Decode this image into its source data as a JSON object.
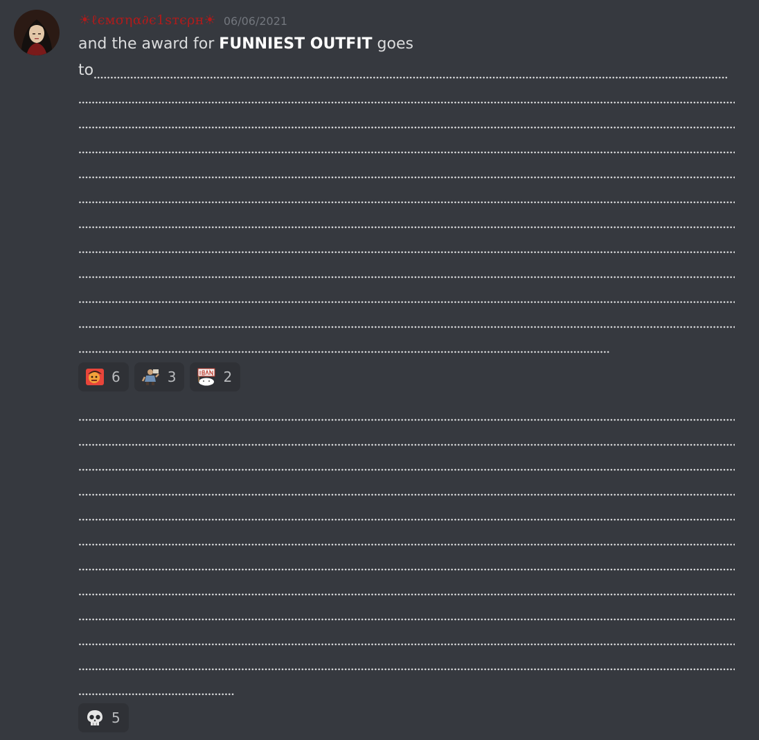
{
  "message": {
    "username": "☀ℓємσηα∂є1ѕтєρн☀",
    "timestamp": "06/06/2021",
    "text_before": "and the award for ",
    "text_bold": "FUNNIEST OUTFIT",
    "text_after": " goes",
    "line2_start": "to"
  },
  "reactions_top": [
    {
      "emoji": "cartoon-character-face-emoji",
      "count": "6"
    },
    {
      "emoji": "cartoon-figure-sticker-emoji",
      "count": "3"
    },
    {
      "emoji": "iban-sign-cat-emoji",
      "count": "2"
    }
  ],
  "reactions_bottom": [
    {
      "emoji": "skull-emoji",
      "count": "5"
    }
  ],
  "colors": {
    "background": "#36393f",
    "username": "#b01b1b",
    "timestamp": "#72767d",
    "text": "#dcddde",
    "reaction_bg": "#2f3136"
  }
}
